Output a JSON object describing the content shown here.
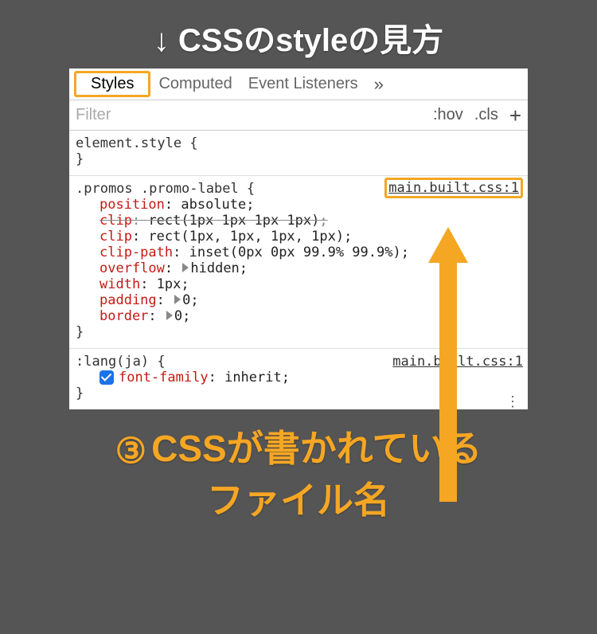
{
  "header": "↓ CSSのstyleの見方",
  "tabs": {
    "styles": "Styles",
    "computed": "Computed",
    "event_listeners": "Event Listeners",
    "more": "»"
  },
  "filter": {
    "placeholder": "Filter",
    "hov": ":hov",
    "cls": ".cls",
    "plus": "+"
  },
  "sections": {
    "element": {
      "selector_open": "element.style {",
      "close": "}"
    },
    "promos": {
      "selector_open": ".promos .promo-label {",
      "src": "main.built.css:1",
      "decls": [
        {
          "prop": "position",
          "val": "absolute",
          "strike": false,
          "tri": false
        },
        {
          "prop": "clip",
          "val": "rect(1px 1px 1px 1px)",
          "strike": true,
          "tri": false
        },
        {
          "prop": "clip",
          "val": "rect(1px, 1px, 1px, 1px)",
          "strike": false,
          "tri": false
        },
        {
          "prop": "clip-path",
          "val": "inset(0px 0px 99.9% 99.9%)",
          "strike": false,
          "tri": false
        },
        {
          "prop": "overflow",
          "val": "hidden",
          "strike": false,
          "tri": true
        },
        {
          "prop": "width",
          "val": "1px",
          "strike": false,
          "tri": false
        },
        {
          "prop": "padding",
          "val": "0",
          "strike": false,
          "tri": true
        },
        {
          "prop": "border",
          "val": "0",
          "strike": false,
          "tri": true
        }
      ],
      "close": "}"
    },
    "lang": {
      "selector_open": ":lang(ja) {",
      "src": "main.built.css:1",
      "decl_prop": "font-family",
      "decl_val": "inherit",
      "close": "}"
    }
  },
  "footer": {
    "num": "③",
    "line1": "CSSが書かれている",
    "line2": "ファイル名"
  }
}
